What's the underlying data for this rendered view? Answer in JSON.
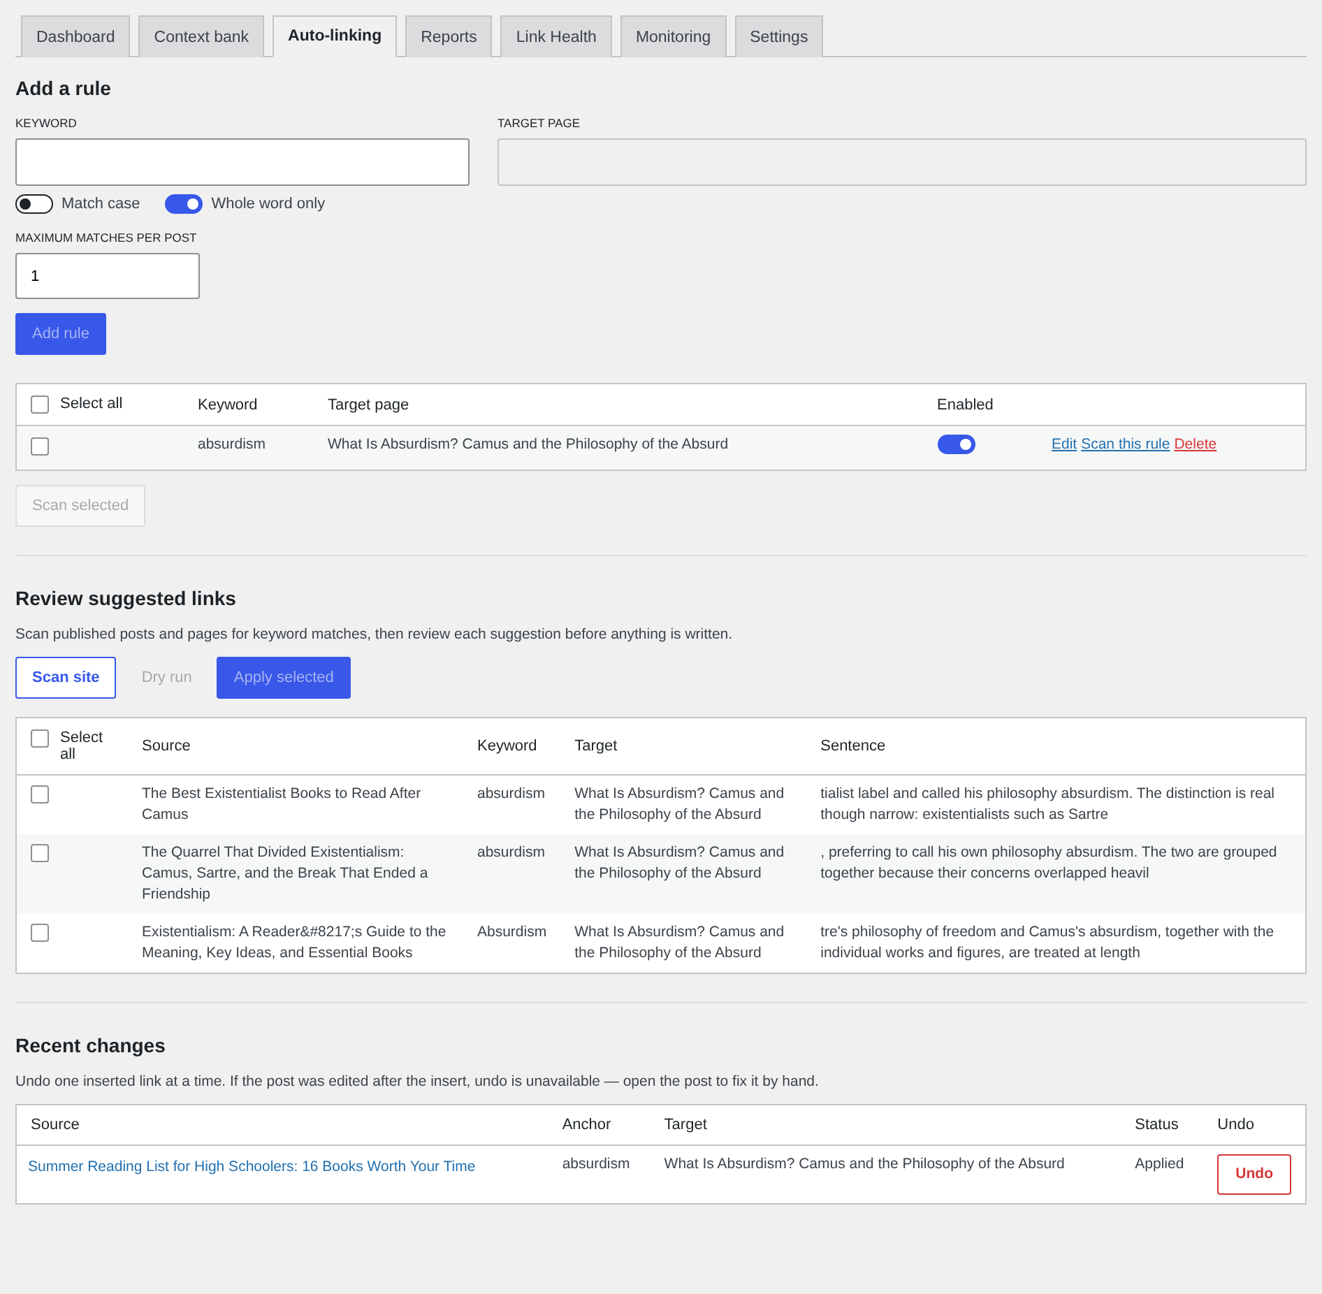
{
  "tabs": [
    {
      "label": "Dashboard",
      "selected": false
    },
    {
      "label": "Context bank",
      "selected": false
    },
    {
      "label": "Auto-linking",
      "selected": true
    },
    {
      "label": "Reports",
      "selected": false
    },
    {
      "label": "Link Health",
      "selected": false
    },
    {
      "label": "Monitoring",
      "selected": false
    },
    {
      "label": "Settings",
      "selected": false
    }
  ],
  "add_rule": {
    "title": "Add a rule",
    "keyword_label": "KEYWORD",
    "target_label": "TARGET PAGE",
    "toggles": [
      {
        "label": "Match case",
        "on": false
      },
      {
        "label": "Whole word only",
        "on": true
      }
    ],
    "max_label": "MAXIMUM MATCHES PER POST",
    "max_value": "1",
    "submit": {
      "label": "Add rule",
      "disabled": true
    }
  },
  "rules_table": {
    "select_all": {
      "label": "Select all",
      "checked": false
    },
    "columns": [
      "Keyword",
      "Target page",
      "Enabled"
    ],
    "rows": [
      {
        "checked": false,
        "keyword": "absurdism",
        "target": "What Is Absurdism? Camus and the Philosophy of the Absurd",
        "enabled": true,
        "actions": [
          {
            "label": "Edit",
            "kind": "link"
          },
          {
            "label": "Scan this rule",
            "kind": "link"
          },
          {
            "label": "Delete",
            "kind": "danger"
          }
        ]
      }
    ]
  },
  "scan_selected": {
    "label": "Scan selected",
    "disabled": true
  },
  "review": {
    "title": "Review suggested links",
    "description": "Scan published posts and pages for keyword matches, then review each suggestion before anything is written.",
    "buttons": [
      {
        "label": "Scan site",
        "kind": "secondary",
        "disabled": false
      },
      {
        "label": "Dry run",
        "kind": "plain",
        "disabled": true
      },
      {
        "label": "Apply selected",
        "kind": "primary",
        "disabled": true
      }
    ],
    "table": {
      "select_all": {
        "label": "Select all",
        "checked": false
      },
      "columns": [
        "Source",
        "Keyword",
        "Target",
        "Sentence"
      ],
      "rows": [
        {
          "checked": false,
          "source": "The Best Existentialist Books to Read After Camus",
          "keyword": "absurdism",
          "target": "What Is Absurdism? Camus and the Philosophy of the Absurd",
          "sentence": "tialist label and called his philosophy absurdism. The distinction is real though narrow: existentialists such as Sartre"
        },
        {
          "checked": false,
          "source": "The Quarrel That Divided Existentialism: Camus, Sartre, and the Break That Ended a Friendship",
          "keyword": "absurdism",
          "target": "What Is Absurdism? Camus and the Philosophy of the Absurd",
          "sentence": ", preferring to call his own philosophy absurdism. The two are grouped together because their concerns overlapped heavil"
        },
        {
          "checked": false,
          "source": "Existentialism: A Reader&#8217;s Guide to the Meaning, Key Ideas, and Essential Books",
          "keyword": "Absurdism",
          "target": "What Is Absurdism? Camus and the Philosophy of the Absurd",
          "sentence": "tre's philosophy of freedom and Camus's absurdism, together with the individual works and figures, are treated at length"
        }
      ]
    }
  },
  "recent": {
    "title": "Recent changes",
    "description": "Undo one inserted link at a time. If the post was edited after the insert, undo is unavailable — open the post to fix it by hand.",
    "columns": [
      "Source",
      "Anchor",
      "Target",
      "Status",
      "Undo"
    ],
    "rows": [
      {
        "source": "Summer Reading List for High Schoolers: 16 Books Worth Your Time",
        "anchor": "absurdism",
        "target": "What Is Absurdism? Camus and the Philosophy of the Absurd",
        "status": "Applied",
        "undo": "Undo"
      }
    ]
  }
}
